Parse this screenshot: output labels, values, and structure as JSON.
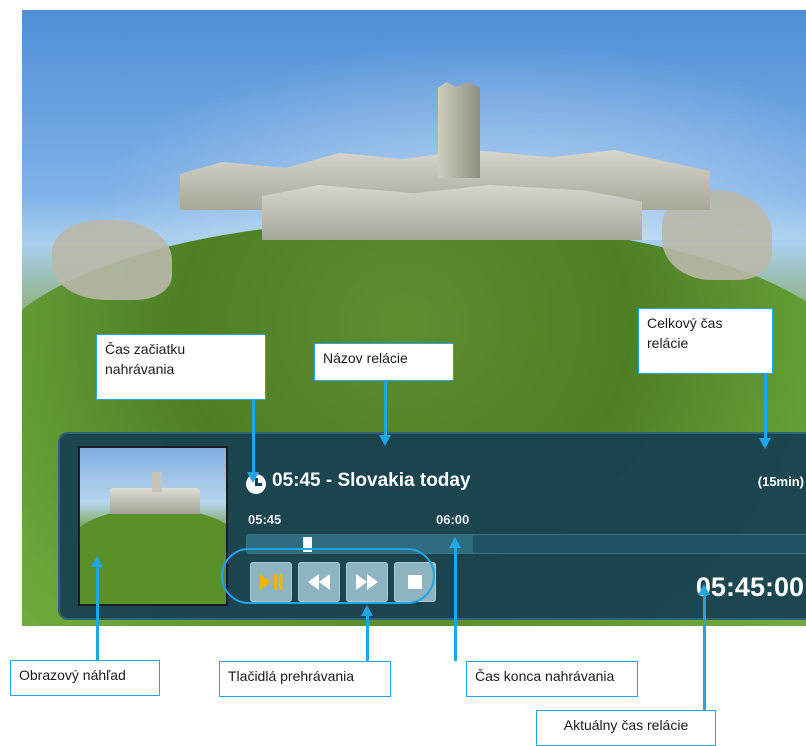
{
  "player": {
    "program_title": "05:45 - Slovakia today",
    "duration": "(15min)",
    "start_time": "05:45",
    "end_time": "06:00",
    "current_time": "05:45:00",
    "progress_fraction": 0.0,
    "recorded_fraction": 0.4,
    "controls": [
      "play-pause-icon",
      "rewind-icon",
      "fast-forward-icon",
      "stop-icon"
    ],
    "accent_color": "#f0b400"
  },
  "callouts": {
    "start": "Čas začiatku nahrávania",
    "title": "Názov relácie",
    "total": "Celkový čas relácie",
    "thumb": "Obrazový náhľad",
    "buttons": "Tlačidlá prehrávania",
    "end": "Čas konca nahrávania",
    "current": "Aktuálny čas relácie"
  },
  "colors": {
    "callout_border": "#1fa6e8",
    "osd_background": "#174052"
  }
}
